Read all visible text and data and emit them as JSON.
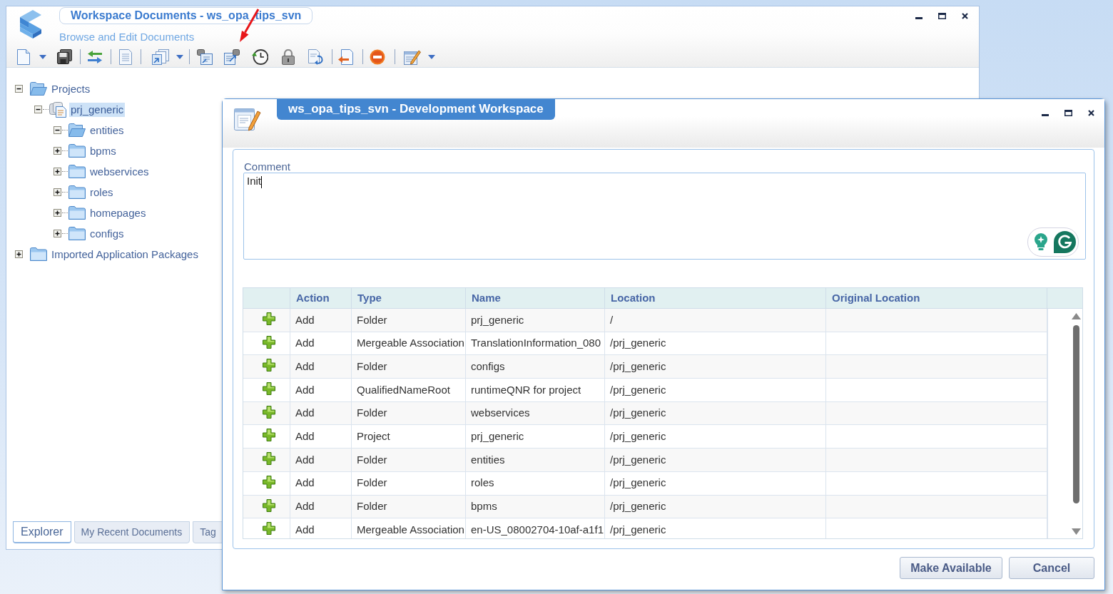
{
  "workspace_window": {
    "title": "Workspace Documents - ws_opa_tips_svn",
    "subtitle": "Browse and Edit Documents",
    "tree": [
      {
        "label": "Projects",
        "kind": "folder",
        "expanded": true,
        "selected": false,
        "children": [
          {
            "label": "prj_generic",
            "kind": "project",
            "expanded": true,
            "selected": true,
            "children": [
              {
                "label": "entities",
                "kind": "folder",
                "expanded": true,
                "selected": false
              },
              {
                "label": "bpms",
                "kind": "folder",
                "expanded": false,
                "selected": false
              },
              {
                "label": "webservices",
                "kind": "folder",
                "expanded": false,
                "selected": false
              },
              {
                "label": "roles",
                "kind": "folder",
                "expanded": false,
                "selected": false
              },
              {
                "label": "homepages",
                "kind": "folder",
                "expanded": false,
                "selected": false
              },
              {
                "label": "configs",
                "kind": "folder",
                "expanded": false,
                "selected": false
              }
            ]
          }
        ]
      },
      {
        "label": "Imported Application Packages",
        "kind": "folder",
        "expanded": false,
        "selected": false
      }
    ],
    "tabs": [
      {
        "label": "Explorer",
        "selected": true
      },
      {
        "label": "My Recent Documents",
        "selected": false
      },
      {
        "label": "Tag",
        "selected": false
      }
    ]
  },
  "dialog": {
    "title": "ws_opa_tips_svn - Development Workspace",
    "comment": {
      "label": "Comment",
      "value": "Init"
    },
    "table": {
      "columns": [
        "Action",
        "Type",
        "Name",
        "Location",
        "Original Location"
      ],
      "rows": [
        {
          "action": "Add",
          "type": "Folder",
          "name": "prj_generic",
          "location": "/"
        },
        {
          "action": "Add",
          "type": "Mergeable Association",
          "name": "TranslationInformation_080",
          "location": "/prj_generic"
        },
        {
          "action": "Add",
          "type": "Folder",
          "name": "configs",
          "location": "/prj_generic"
        },
        {
          "action": "Add",
          "type": "QualifiedNameRoot",
          "name": "runtimeQNR for project",
          "location": "/prj_generic"
        },
        {
          "action": "Add",
          "type": "Folder",
          "name": "webservices",
          "location": "/prj_generic"
        },
        {
          "action": "Add",
          "type": "Project",
          "name": "prj_generic",
          "location": "/prj_generic"
        },
        {
          "action": "Add",
          "type": "Folder",
          "name": "entities",
          "location": "/prj_generic"
        },
        {
          "action": "Add",
          "type": "Folder",
          "name": "roles",
          "location": "/prj_generic"
        },
        {
          "action": "Add",
          "type": "Folder",
          "name": "bpms",
          "location": "/prj_generic"
        },
        {
          "action": "Add",
          "type": "Mergeable Association",
          "name": "en-US_08002704-10af-a1f1",
          "location": "/prj_generic"
        }
      ]
    },
    "buttons": [
      "Make Available",
      "Cancel"
    ]
  }
}
